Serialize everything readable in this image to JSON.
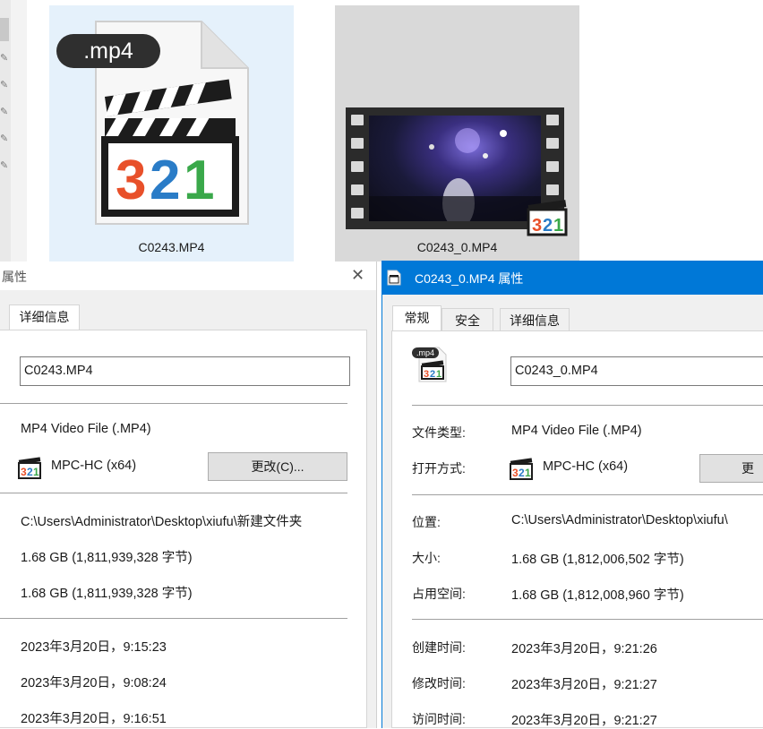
{
  "explorer": {
    "file1": {
      "name": "C0243.MP4",
      "ext_badge": ".mp4",
      "icon_digits": "321"
    },
    "file2": {
      "name": "C0243_0.MP4",
      "icon_digits": "321"
    }
  },
  "left_dialog": {
    "title": "属性",
    "tabs": [
      "详细信息"
    ],
    "filename": "C0243.MP4",
    "file_type": "MP4 Video File (.MP4)",
    "open_with": "MPC-HC (x64)",
    "change_button": "更改(C)...",
    "location": "C:\\Users\\Administrator\\Desktop\\xiufu\\新建文件夹",
    "size": "1.68 GB (1,811,939,328 字节)",
    "size_on_disk": "1.68 GB (1,811,939,328 字节)",
    "created": "2023年3月20日，9:15:23",
    "modified": "2023年3月20日，9:08:24",
    "accessed": "2023年3月20日，9:16:51"
  },
  "right_dialog": {
    "title": "C0243_0.MP4 属性",
    "tabs": [
      "常规",
      "安全",
      "详细信息"
    ],
    "filename": "C0243_0.MP4",
    "icon_badge": ".mp4",
    "labels": {
      "file_type": "文件类型:",
      "open_with": "打开方式:",
      "location": "位置:",
      "size": "大小:",
      "size_on_disk": "占用空间:",
      "created": "创建时间:",
      "modified": "修改时间:",
      "accessed": "访问时间:"
    },
    "file_type": "MP4 Video File (.MP4)",
    "open_with": "MPC-HC (x64)",
    "change_button": "更改",
    "location": "C:\\Users\\Administrator\\Desktop\\xiufu\\",
    "size": "1.68 GB (1,812,006,502 字节)",
    "size_on_disk": "1.68 GB (1,812,008,960 字节)",
    "created": "2023年3月20日，9:21:26",
    "modified": "2023年3月20日，9:21:27",
    "accessed": "2023年3月20日，9:21:27"
  },
  "colors": {
    "accent": "#0078d7",
    "selection": "#e5f1fb"
  }
}
